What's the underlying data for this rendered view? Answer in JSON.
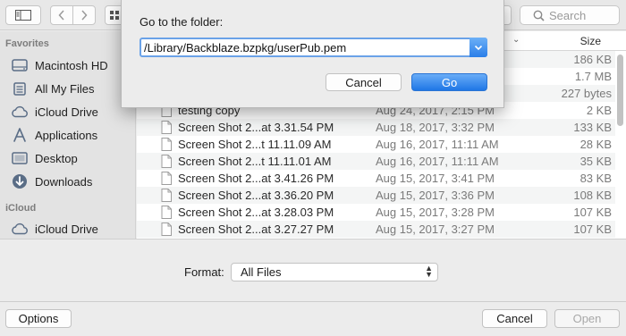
{
  "toolbar": {
    "search_placeholder": "Search"
  },
  "sidebar": {
    "favorites_label": "Favorites",
    "icloud_label": "iCloud",
    "favorites": [
      {
        "label": "Macintosh HD",
        "icon": "hard-drive-icon"
      },
      {
        "label": "All My Files",
        "icon": "all-files-icon"
      },
      {
        "label": "iCloud Drive",
        "icon": "cloud-icon"
      },
      {
        "label": "Applications",
        "icon": "applications-icon"
      },
      {
        "label": "Desktop",
        "icon": "desktop-icon"
      },
      {
        "label": "Downloads",
        "icon": "downloads-icon"
      }
    ],
    "icloud": [
      {
        "label": "iCloud Drive",
        "icon": "cloud-icon"
      }
    ]
  },
  "file_list": {
    "size_header": "Size",
    "rows": [
      {
        "name": "",
        "date": "",
        "size": "186 KB"
      },
      {
        "name": "",
        "date": "",
        "size": "1.7 MB"
      },
      {
        "name": "",
        "date": "",
        "size": "227 bytes"
      },
      {
        "name": "testing copy",
        "date": "Aug 24, 2017, 2:15 PM",
        "size": "2 KB"
      },
      {
        "name": "Screen Shot 2...at 3.31.54 PM",
        "date": "Aug 18, 2017, 3:32 PM",
        "size": "133 KB"
      },
      {
        "name": "Screen Shot 2...t 11.11.09 AM",
        "date": "Aug 16, 2017, 11:11 AM",
        "size": "28 KB"
      },
      {
        "name": "Screen Shot 2...t 11.11.01 AM",
        "date": "Aug 16, 2017, 11:11 AM",
        "size": "35 KB"
      },
      {
        "name": "Screen Shot 2...at 3.41.26 PM",
        "date": "Aug 15, 2017, 3:41 PM",
        "size": "83 KB"
      },
      {
        "name": "Screen Shot 2...at 3.36.20 PM",
        "date": "Aug 15, 2017, 3:36 PM",
        "size": "108 KB"
      },
      {
        "name": "Screen Shot 2...at 3.28.03 PM",
        "date": "Aug 15, 2017, 3:28 PM",
        "size": "107 KB"
      },
      {
        "name": "Screen Shot 2...at 3.27.27 PM",
        "date": "Aug 15, 2017, 3:27 PM",
        "size": "107 KB"
      }
    ]
  },
  "format": {
    "label": "Format:",
    "selected": "All Files"
  },
  "bottom": {
    "options_label": "Options",
    "cancel_label": "Cancel",
    "open_label": "Open"
  },
  "dialog": {
    "title": "Go to the folder:",
    "path_value": "/Library/Backblaze.bzpkg/userPub.pem",
    "cancel_label": "Cancel",
    "go_label": "Go"
  },
  "colors": {
    "accent": "#2a7ee8",
    "sidebar_icon": "#5a6d86"
  }
}
